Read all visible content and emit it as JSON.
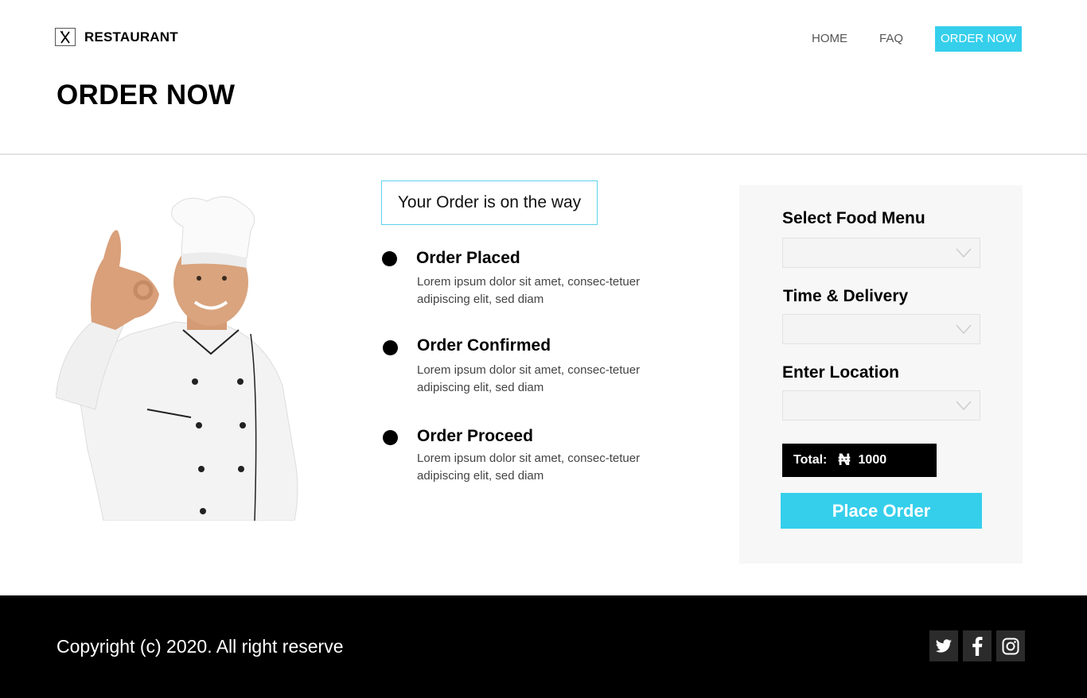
{
  "header": {
    "brand": "RESTAURANT",
    "logo_icon": "fork-knife-icon",
    "nav": {
      "home": "HOME",
      "faq": "FAQ",
      "order_now": "ORDER NOW"
    },
    "page_title": "ORDER NOW"
  },
  "status": {
    "heading": "Your Order is on the way",
    "steps": [
      {
        "title": "Order Placed",
        "desc": "Lorem ipsum dolor sit amet, consec-tetuer adipiscing elit, sed diam"
      },
      {
        "title": "Order Confirmed",
        "desc": "Lorem ipsum dolor sit amet, consec-tetuer adipiscing elit, sed diam"
      },
      {
        "title": "Order Proceed",
        "desc": "Lorem ipsum dolor sit amet, consec-tetuer adipiscing elit, sed diam"
      }
    ]
  },
  "order_form": {
    "food_menu_label": "Select Food Menu",
    "delivery_label": "Time & Delivery",
    "location_label": "Enter Location",
    "total_label": "Total:",
    "currency_symbol": "₦",
    "total_amount": "1000",
    "place_order": "Place Order"
  },
  "footer": {
    "copyright": "Copyright (c) 2020. All right reserve",
    "socials": [
      "twitter-icon",
      "facebook-icon",
      "instagram-icon"
    ]
  },
  "colors": {
    "accent": "#35cfeb",
    "panel_bg": "#f7f7f7",
    "footer_bg": "#000000"
  }
}
